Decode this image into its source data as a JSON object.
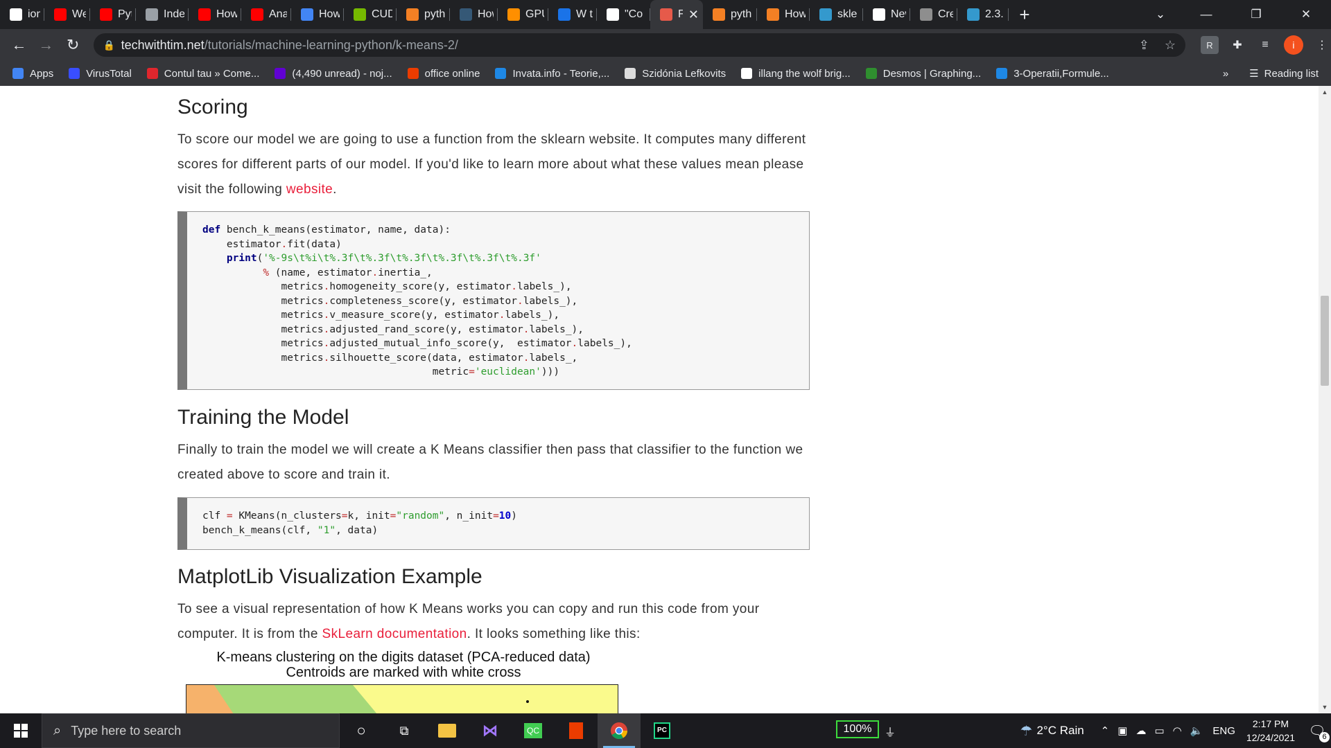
{
  "tabs": [
    {
      "title": "ionu",
      "icon": "github-icon",
      "color": "#ffffff"
    },
    {
      "title": "Web",
      "icon": "youtube-icon",
      "color": "#ff0000"
    },
    {
      "title": "Pyth",
      "icon": "youtube-icon",
      "color": "#ff0000"
    },
    {
      "title": "Inde",
      "icon": "globe-icon",
      "color": "#9aa0a6"
    },
    {
      "title": "How",
      "icon": "youtube-icon",
      "color": "#ff0000"
    },
    {
      "title": "Ana",
      "icon": "youtube-icon",
      "color": "#ff0000"
    },
    {
      "title": "How",
      "icon": "site-icon",
      "color": "#4285f4"
    },
    {
      "title": "CUD",
      "icon": "nvidia-icon",
      "color": "#76b900"
    },
    {
      "title": "pyth",
      "icon": "stackoverflow-icon",
      "color": "#f48024"
    },
    {
      "title": "How",
      "icon": "tds-icon",
      "color": "#355876"
    },
    {
      "title": "GPU",
      "icon": "tensorflow-icon",
      "color": "#ff8f00"
    },
    {
      "title": "W te",
      "icon": "circle-icon",
      "color": "#1a73e8"
    },
    {
      "title": "\"Co",
      "icon": "github-icon",
      "color": "#ffffff"
    },
    {
      "title": "F",
      "icon": "techwithtim-icon",
      "color": "#e65a4a"
    },
    {
      "title": "pyth",
      "icon": "stackoverflow-icon",
      "color": "#f48024"
    },
    {
      "title": "How",
      "icon": "stackoverflow-icon",
      "color": "#f48024"
    },
    {
      "title": "skle",
      "icon": "sklearn-icon",
      "color": "#3499cd"
    },
    {
      "title": "New",
      "icon": "chrome-icon",
      "color": "#ffffff"
    },
    {
      "title": "Crea",
      "icon": "image-icon",
      "color": "#8e8e8e"
    },
    {
      "title": "2.3.",
      "icon": "sklearn-icon",
      "color": "#3499cd"
    }
  ],
  "url": {
    "host": "techwithtim.net",
    "path": "/tutorials/machine-learning-python/k-means-2/"
  },
  "profile_initial": "i",
  "bookmarks": [
    {
      "label": "Apps",
      "icon": "apps-grid-icon",
      "color": "#4285f4"
    },
    {
      "label": "VirusTotal",
      "icon": "virustotal-icon",
      "color": "#394eff"
    },
    {
      "label": "Contul tau » Come...",
      "icon": "emag-icon",
      "color": "#e0262d"
    },
    {
      "label": "(4,490 unread) - noj...",
      "icon": "yahoo-mail-icon",
      "color": "#6001d2"
    },
    {
      "label": "office online",
      "icon": "office-icon",
      "color": "#eb3c00"
    },
    {
      "label": "Invata.info - Teorie,...",
      "icon": "invata-icon",
      "color": "#1e88e5"
    },
    {
      "label": "Szidónia Lefkovits",
      "icon": "site-icon",
      "color": "#dddddd"
    },
    {
      "label": "illang the wolf brig...",
      "icon": "google-icon",
      "color": "#ffffff"
    },
    {
      "label": "Desmos | Graphing...",
      "icon": "desmos-icon",
      "color": "#2f8f2f"
    },
    {
      "label": "3-Operatii,Formule...",
      "icon": "site-icon",
      "color": "#1e88e5"
    }
  ],
  "bookmarks_more": "»",
  "reading_list": "Reading list",
  "content": {
    "scoring": {
      "heading": "Scoring",
      "para_before": "To score our model we are going to use a function from the sklearn website. It computes many different scores for different parts of our model. If you'd like to learn more about what these values mean please visit the following ",
      "link": "website",
      "para_after": "."
    },
    "training": {
      "heading": "Training the Model",
      "para": "Finally to train the model we will create a K Means classifier then pass that classifier to the function we created above to score and train it."
    },
    "matplotlib": {
      "heading": "MatplotLib Visualization Example",
      "para_before": "To see a visual representation of how K Means works you can copy and run this code from your computer. It is from the ",
      "link": "SkLearn documentation",
      "para_after": ". It looks something like this:",
      "figure_title_1": "K-means clustering on the digits dataset (PCA-reduced data)",
      "figure_title_2": "Centroids are marked with white cross"
    }
  },
  "taskbar": {
    "search_placeholder": "Type here to search",
    "zoom": "100%",
    "weather": "2°C  Rain",
    "language": "ENG",
    "time": "2:17 PM",
    "date": "12/24/2021",
    "notifications": "6"
  }
}
